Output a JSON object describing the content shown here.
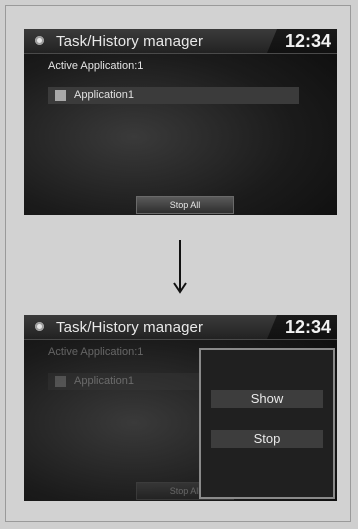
{
  "screens": [
    {
      "title": "Task/History manager",
      "clock": "12:34",
      "active_label": "Active Application:1",
      "application": "Application1",
      "stop_all": "Stop All"
    },
    {
      "title": "Task/History manager",
      "clock": "12:34",
      "active_label": "Active Application:1",
      "application": "Application1",
      "stop_all": "Stop All",
      "popup": {
        "show_label": "Show",
        "stop_label": "Stop"
      }
    }
  ],
  "icons": {
    "menu": "menu-dot-icon",
    "arrow": "arrow-down-icon"
  }
}
